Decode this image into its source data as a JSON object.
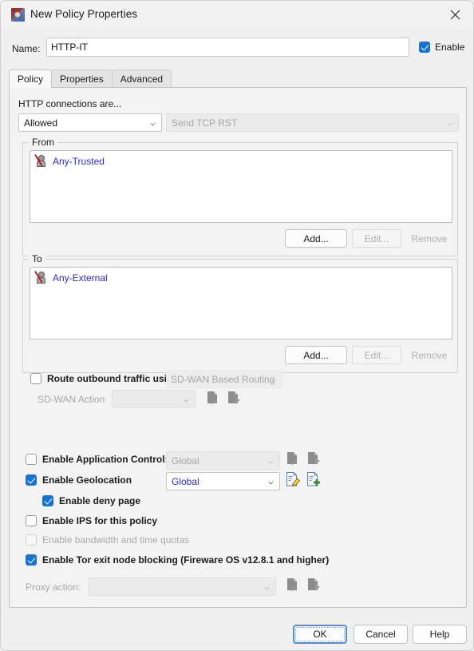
{
  "window": {
    "title": "New Policy Properties",
    "icon": "policy-app-icon",
    "close_icon": "close-icon"
  },
  "name_row": {
    "label": "Name:",
    "value": "HTTP-IT",
    "placeholder": "",
    "enable_label": "Enable",
    "enable_checked": true
  },
  "tabs": [
    {
      "label": "Policy",
      "active": true
    },
    {
      "label": "Properties",
      "active": false
    },
    {
      "label": "Advanced",
      "active": false
    }
  ],
  "policy_tab": {
    "connections_label": "HTTP connections are...",
    "action_select": {
      "value": "Allowed",
      "enabled": true
    },
    "response_select": {
      "value": "Send TCP RST",
      "enabled": false
    },
    "from_group": {
      "title": "From",
      "items": [
        {
          "label": "Any-Trusted",
          "icon": "any-trusted-icon"
        }
      ],
      "buttons": [
        {
          "label": "Add...",
          "enabled": true
        },
        {
          "label": "Edit...",
          "enabled": false
        },
        {
          "label": "Remove",
          "enabled": false
        }
      ]
    },
    "to_group": {
      "title": "To",
      "items": [
        {
          "label": "Any-External",
          "icon": "any-external-icon"
        }
      ],
      "buttons": [
        {
          "label": "Add...",
          "enabled": true
        },
        {
          "label": "Edit...",
          "enabled": false
        },
        {
          "label": "Remove",
          "enabled": false
        }
      ]
    },
    "route_outbound": {
      "label": "Route outbound traffic using",
      "checked": false,
      "select": {
        "value": "SD-WAN Based Routing",
        "enabled": false
      }
    },
    "sdwan_action": {
      "label": "SD-WAN Action",
      "select": {
        "value": "",
        "enabled": false
      },
      "edit_icon": "edit-page-icon",
      "new_icon": "new-page-icon"
    }
  },
  "options": {
    "application_control": {
      "label": "Enable Application Control:",
      "checked": false,
      "select": {
        "value": "Global",
        "enabled": false
      },
      "edit_icon": "edit-page-icon",
      "new_icon": "new-page-icon"
    },
    "geolocation": {
      "label": "Enable Geolocation",
      "checked": true,
      "select": {
        "value": "Global",
        "enabled": true
      },
      "edit_icon": "edit-page-icon",
      "new_icon": "new-page-icon"
    },
    "deny_page": {
      "label": "Enable deny page",
      "checked": true
    },
    "ips": {
      "label": "Enable IPS for this policy",
      "checked": false,
      "enabled": true
    },
    "quotas": {
      "label": "Enable bandwidth and time quotas",
      "checked": false,
      "enabled": false
    },
    "tor": {
      "label": "Enable Tor exit node blocking (Fireware OS v12.8.1 and higher)",
      "checked": true
    },
    "proxy_action": {
      "label": "Proxy action:",
      "select": {
        "value": "",
        "enabled": false
      },
      "edit_icon": "edit-page-icon",
      "new_icon": "new-page-icon"
    }
  },
  "footer": {
    "ok": "OK",
    "cancel": "Cancel",
    "help": "Help"
  },
  "colors": {
    "accent": "#1873cf",
    "link": "#2a2ad6",
    "focus": "#4d90d9"
  }
}
